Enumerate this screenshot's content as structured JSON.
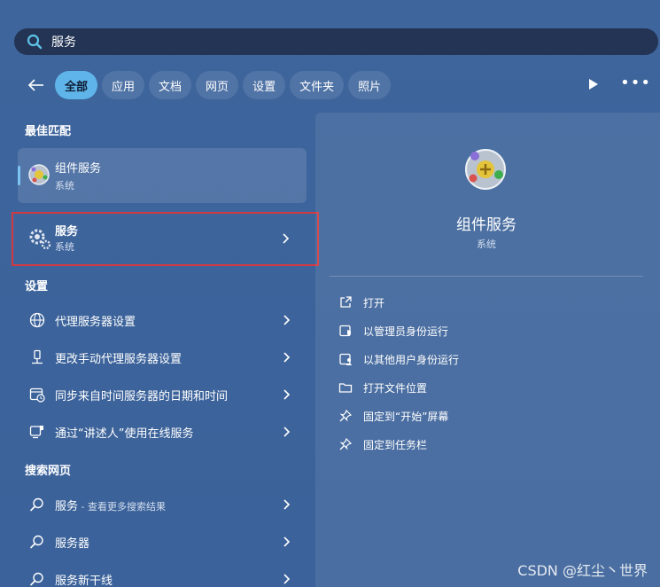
{
  "search": {
    "query": "服务"
  },
  "filters": {
    "tabs": [
      "全部",
      "应用",
      "文档",
      "网页",
      "设置",
      "文件夹",
      "照片"
    ]
  },
  "sections": {
    "best_match": "最佳匹配",
    "settings": "设置",
    "web": "搜索网页"
  },
  "best_match": {
    "title": "组件服务",
    "subtitle": "系统"
  },
  "service": {
    "title": "服务",
    "subtitle": "系统"
  },
  "settings_items": [
    "代理服务器设置",
    "更改手动代理服务器设置",
    "同步来自时间服务器的日期和时间",
    "通过“讲述人”使用在线服务"
  ],
  "web_items": [
    {
      "text": "服务",
      "note": " - 查看更多搜索结果"
    },
    {
      "text": "服务器",
      "note": ""
    },
    {
      "text": "服务新干线",
      "note": ""
    }
  ],
  "preview": {
    "title": "组件服务",
    "subtitle": "系统",
    "actions": [
      "打开",
      "以管理员身份运行",
      "以其他用户身份运行",
      "打开文件位置",
      "固定到“开始”屏幕",
      "固定到任务栏"
    ]
  },
  "watermark": "CSDN @红尘丶世界",
  "colors": {
    "accent": "#5fb5ea",
    "highlight_border": "#d23a43",
    "search_bg": "#233454"
  }
}
